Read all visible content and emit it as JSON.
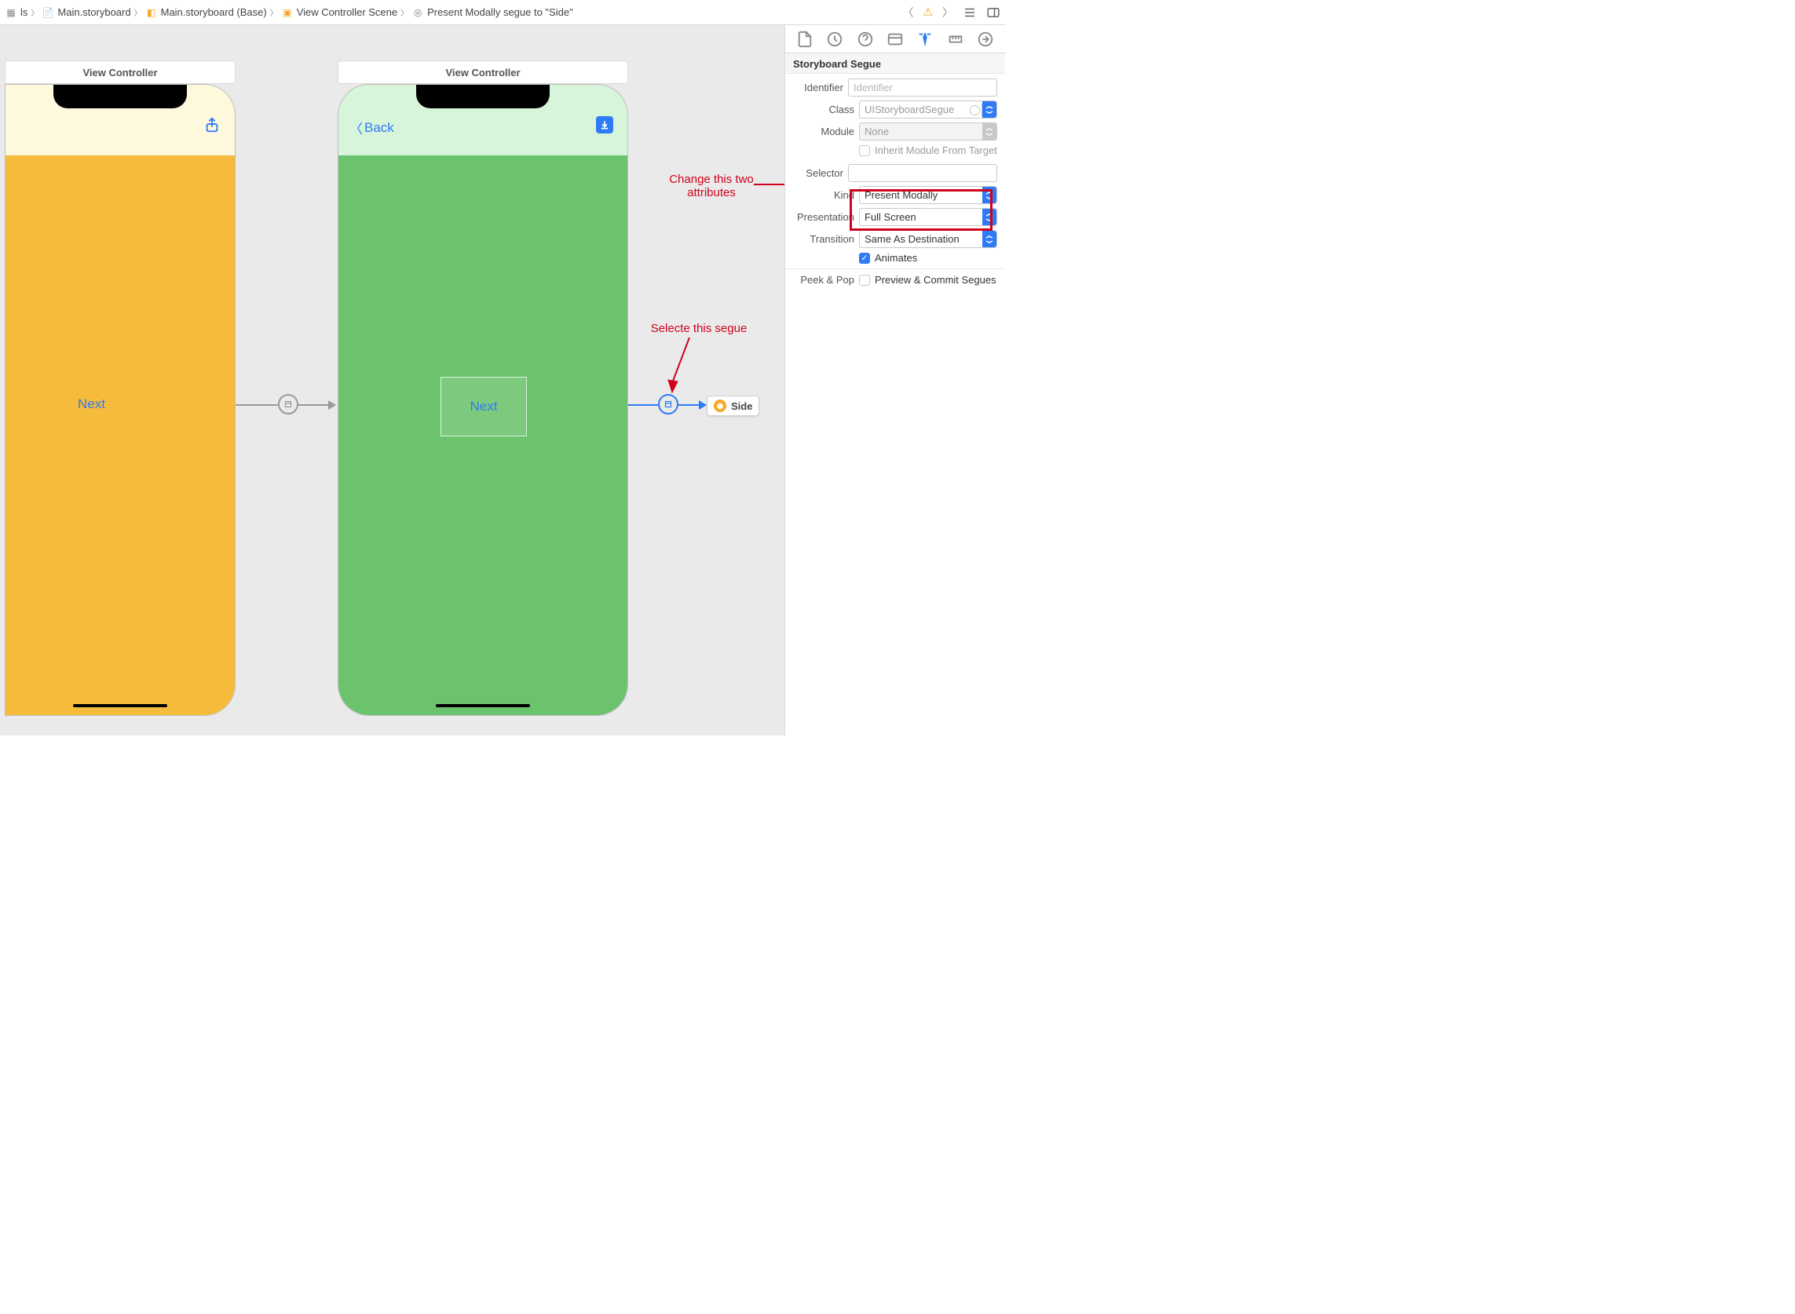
{
  "breadcrumbs": {
    "items": [
      {
        "label": "ls"
      },
      {
        "label": "Main.storyboard"
      },
      {
        "label": "Main.storyboard (Base)"
      },
      {
        "label": "View Controller Scene"
      },
      {
        "label": "Present Modally segue to \"Side\""
      }
    ]
  },
  "canvas": {
    "scene1_title": "View Controller",
    "scene2_title": "View Controller",
    "scene1_button": "Next",
    "scene2_back": "Back",
    "scene2_button": "Next",
    "side_chip": "Side"
  },
  "annotations": {
    "change_attrs": "Change this two\nattributes",
    "select_segue": "Selecte this segue"
  },
  "inspector": {
    "section": "Storyboard Segue",
    "fields": {
      "identifier_label": "Identifier",
      "identifier_placeholder": "Identifier",
      "identifier_value": "",
      "class_label": "Class",
      "class_value": "UIStoryboardSegue",
      "module_label": "Module",
      "module_value": "None",
      "inherit_label": "Inherit Module From Target",
      "selector_label": "Selector",
      "selector_value": "",
      "kind_label": "Kind",
      "kind_value": "Present Modally",
      "presentation_label": "Presentation",
      "presentation_value": "Full Screen",
      "transition_label": "Transition",
      "transition_value": "Same As Destination",
      "animates_label": "Animates",
      "peek_label": "Peek & Pop",
      "peek_option": "Preview & Commit Segues"
    }
  }
}
